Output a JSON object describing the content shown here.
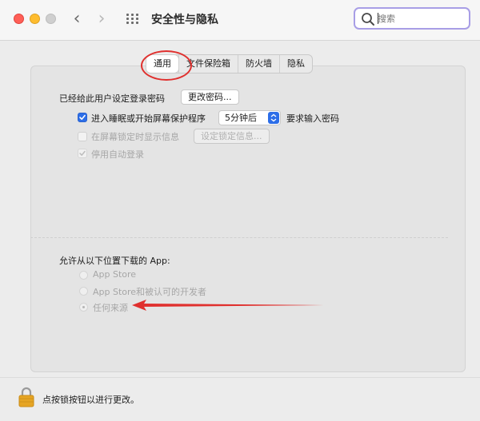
{
  "window": {
    "title": "安全性与隐私",
    "search_placeholder": "搜索",
    "search_value": ""
  },
  "tabs": [
    {
      "label": "通用",
      "active": true
    },
    {
      "label": "文件保险箱",
      "active": false
    },
    {
      "label": "防火墙",
      "active": false
    },
    {
      "label": "隐私",
      "active": false
    }
  ],
  "general": {
    "password_label": "已经给此用户设定登录密码",
    "change_password_button": "更改密码...",
    "require_password": {
      "label_prefix": "进入睡眠或开始屏幕保护程序",
      "checked": true,
      "delay": "5分钟后",
      "label_suffix": "要求输入密码"
    },
    "show_message": {
      "label": "在屏幕锁定时显示信息",
      "checked": false,
      "button": "设定锁定信息..."
    },
    "disable_autologin": {
      "label": "停用自动登录",
      "checked": true
    }
  },
  "downloads": {
    "heading": "允许从以下位置下载的 App:",
    "options": [
      {
        "label": "App Store",
        "selected": false
      },
      {
        "label": "App Store和被认可的开发者",
        "selected": false
      },
      {
        "label": "任何来源",
        "selected": true
      }
    ]
  },
  "footer": {
    "lock_text": "点按锁按钮以进行更改。"
  },
  "colors": {
    "accent": "#2d6ee8",
    "annotation": "#e0302e",
    "search_focus": "#a89ee6"
  }
}
